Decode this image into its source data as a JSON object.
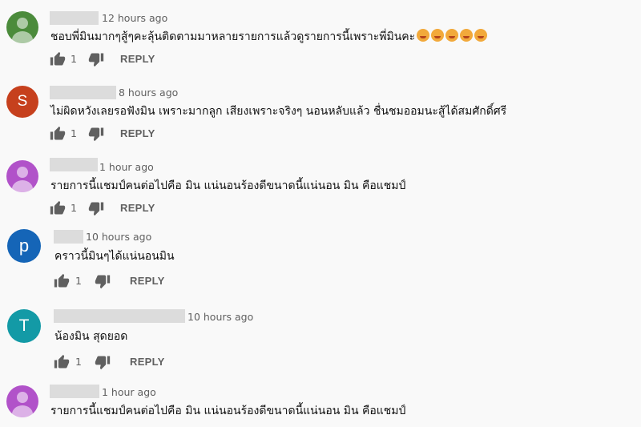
{
  "comments": [
    {
      "avatar_color": "#4b8b3b",
      "avatar_letter": "",
      "time": "12 hours ago",
      "text": "ชอบพี่มินมากๆสู้ๆคะลุ้นติดตามมาหลายรายการแล้วดูรายการนี้เพราะพี่มินคะ",
      "emoji_count": 5,
      "likes": "1",
      "reply_label": "REPLY"
    },
    {
      "avatar_color": "#c6401d",
      "avatar_letter": "S",
      "time": "8 hours ago",
      "text": "ไม่ผิดหวังเลยรอฟังมิน เพราะมากลูก เสียงเพราะจริงๆ นอนหลับแล้ว ชื่นชมออมนะสู้ได้สมศักดิ์ศรี",
      "emoji_count": 0,
      "likes": "1",
      "reply_label": "REPLY"
    },
    {
      "avatar_color": "#b152c9",
      "avatar_letter": "",
      "time": "1 hour ago",
      "text": "รายการนี้แชมป์คนต่อไปคือ มิน แน่นอนร้องดีขนาดนี้แน่นอน มิน คือแชมป์",
      "emoji_count": 0,
      "likes": "1",
      "reply_label": "REPLY"
    },
    {
      "avatar_color": "#1565b7",
      "avatar_letter": "p",
      "time": "10 hours ago",
      "text": "คราวนี้มินๆได้แน่นอนมิน",
      "emoji_count": 0,
      "likes": "1",
      "reply_label": "REPLY"
    },
    {
      "avatar_color": "#139aa6",
      "avatar_letter": "T",
      "time": "10 hours ago",
      "text": "น้องมิน สุดยอด",
      "emoji_count": 0,
      "likes": "1",
      "reply_label": "REPLY"
    },
    {
      "avatar_color": "#b152c9",
      "avatar_letter": "",
      "time": "1 hour ago",
      "text": "รายการนี้แชมป์คนต่อไปคือ มิน แน่นอนร้องดีขนาดนี้แน่นอน มิน คือแชมป์",
      "emoji_count": 0,
      "likes": "",
      "reply_label": ""
    }
  ]
}
